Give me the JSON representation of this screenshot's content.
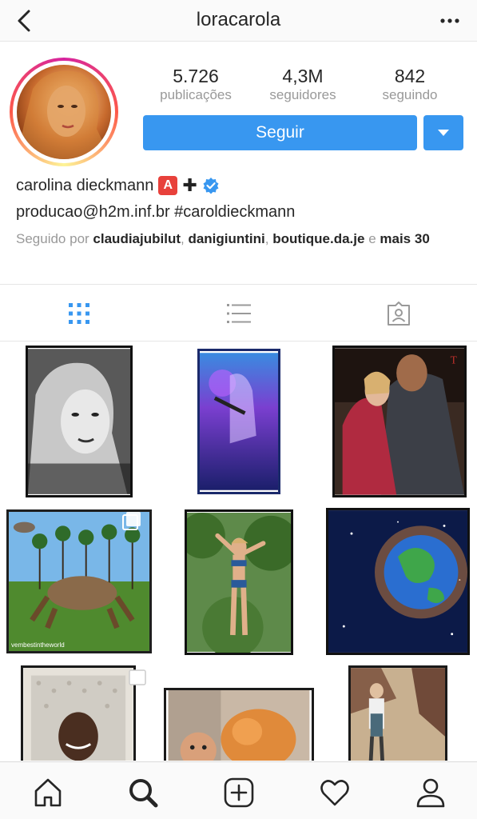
{
  "header": {
    "username": "loracarola"
  },
  "stats": [
    {
      "value": "5.726",
      "label": "publicações"
    },
    {
      "value": "4,3M",
      "label": "seguidores"
    },
    {
      "value": "842",
      "label": "seguindo"
    }
  ],
  "actions": {
    "follow_label": "Seguir"
  },
  "profile": {
    "full_name": "carolina dieckmann",
    "badge_letter": "A",
    "plus_symbol": "✚",
    "bio": "producao@h2m.inf.br #caroldieckmann",
    "followed_by_prefix": "Seguido por",
    "followed_by_users": [
      "claudiajubilut",
      "danigiuntini",
      "boutique.da.je"
    ],
    "followed_by_conjunction": "e",
    "followed_by_more": "mais 30"
  },
  "grid": {
    "tags": [
      "vembestintheworld"
    ]
  },
  "colors": {
    "accent": "#3897f0",
    "verified": "#3897f0",
    "badge": "#e8413b"
  }
}
